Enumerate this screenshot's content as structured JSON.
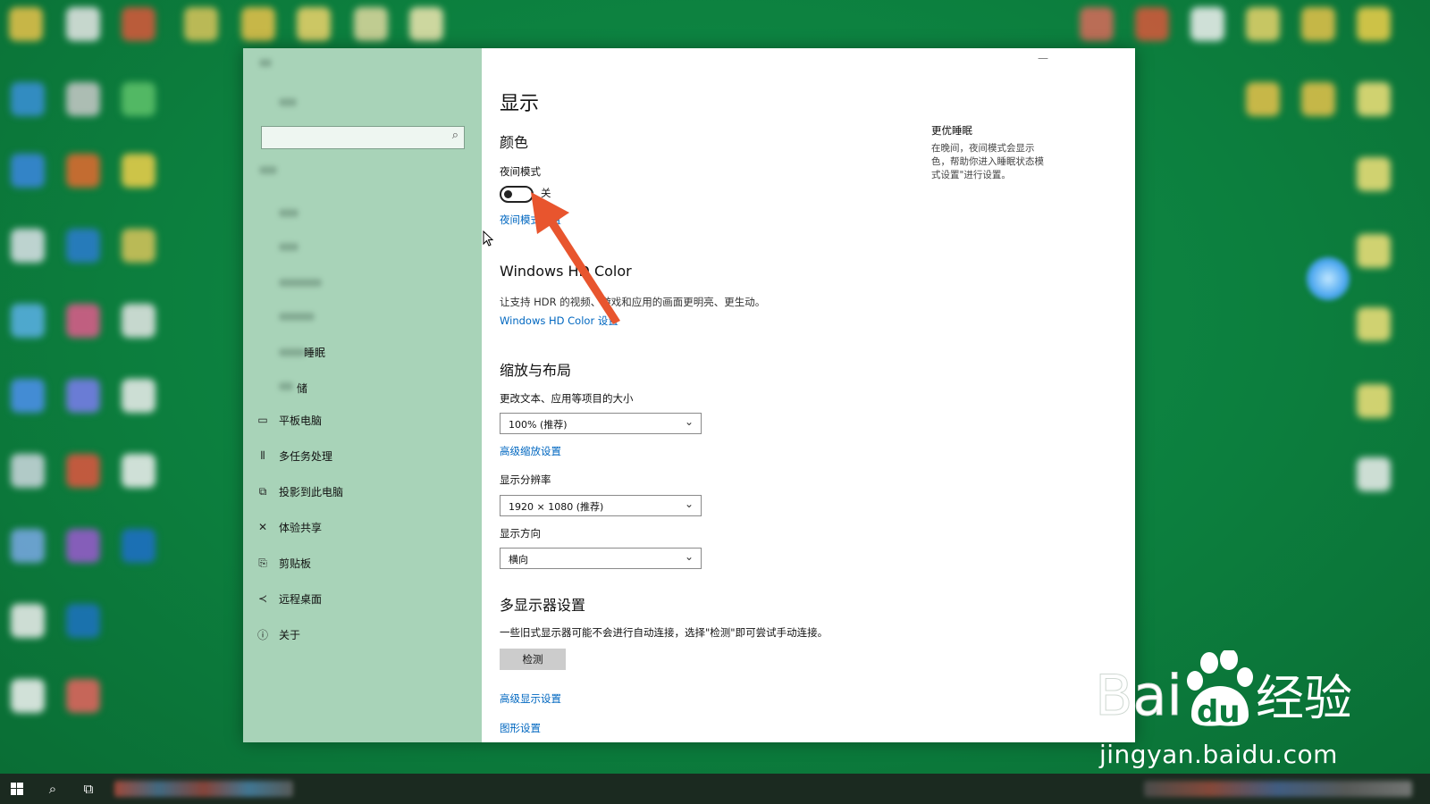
{
  "window": {
    "page_title": "显示",
    "minimize_glyph": "—"
  },
  "sidebar": {
    "items": [
      {
        "label": "平板电脑",
        "icon": "tablet-icon",
        "glyph": "▭"
      },
      {
        "label": "多任务处理",
        "icon": "multitasking-icon",
        "glyph": "⫴"
      },
      {
        "label": "投影到此电脑",
        "icon": "project-icon",
        "glyph": "⧉"
      },
      {
        "label": "体验共享",
        "icon": "shared-experiences-icon",
        "glyph": "✕"
      },
      {
        "label": "剪贴板",
        "icon": "clipboard-icon",
        "glyph": "⎘"
      },
      {
        "label": "远程桌面",
        "icon": "remote-desktop-icon",
        "glyph": "≺"
      },
      {
        "label": "关于",
        "icon": "info-icon",
        "glyph": "ⓘ"
      }
    ],
    "partial_items": [
      {
        "label": "睡眠"
      },
      {
        "label": "储"
      }
    ]
  },
  "color_section": {
    "heading": "颜色",
    "night_mode_label": "夜间模式",
    "toggle_state": "关",
    "night_mode_link": "夜间模式设置"
  },
  "hdr_section": {
    "heading": "Windows HD Color",
    "description": "让支持 HDR 的视频、游戏和应用的画面更明亮、更生动。",
    "link": "Windows HD Color 设置"
  },
  "scale_section": {
    "heading": "缩放与布局",
    "text_size_label": "更改文本、应用等项目的大小",
    "scale_value": "100% (推荐)",
    "advanced_scale_link": "高级缩放设置",
    "resolution_label": "显示分辨率",
    "resolution_value": "1920 × 1080 (推荐)",
    "orientation_label": "显示方向",
    "orientation_value": "横向"
  },
  "multi_display": {
    "heading": "多显示器设置",
    "description": "一些旧式显示器可能不会进行自动连接，选择\"检测\"即可尝试手动连接。",
    "detect_button": "检测",
    "advanced_display_link": "高级显示设置",
    "graphics_link": "图形设置"
  },
  "right_panel": {
    "heading": "更优睡眠",
    "description": "在晚间，夜间模式会显示色，帮助你进入睡眠状态模式设置\"进行设置。"
  },
  "watermark": {
    "brand_text": "Bai",
    "brand_du": "du",
    "brand_cn": "经验",
    "url": "jingyan.baidu.com"
  },
  "colors": {
    "desktop_green": "#0c7f3e",
    "sidebar_bg": "#a8d3b8",
    "link_blue": "#0067c0",
    "arrow_red": "#e8552e"
  }
}
